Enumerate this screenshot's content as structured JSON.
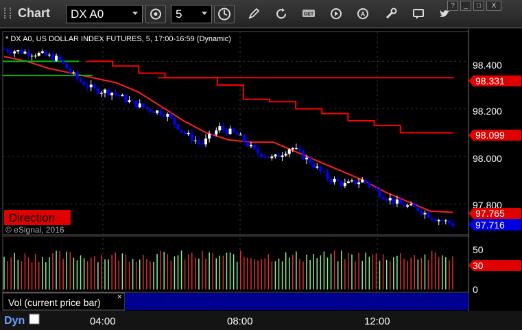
{
  "toolbar": {
    "title": "Chart",
    "symbol_value": "DX A0",
    "interval_value": "5",
    "icons": [
      "link-settings-icon",
      "clock-icon",
      "pencil-icon",
      "refresh-icon",
      "get-icon",
      "play-icon",
      "alert-icon",
      "wrench-icon",
      "comment-icon",
      "twitter-icon"
    ],
    "get_label": "GET",
    "alert_label": "A"
  },
  "window_controls": {
    "help": "?",
    "minimize": "_",
    "maximize": "□",
    "close": "X"
  },
  "chart": {
    "header": "* DX A0, US DOLLAR INDEX FUTURES, 5, 17:00-16:59 (Dynamic)",
    "watermark": "© eSignal, 2016",
    "direction_label": "Direction",
    "price_axis_ticks": [
      "98.400",
      "98.200",
      "98.000",
      "97.800"
    ],
    "price_markers": [
      {
        "value": "98.331",
        "color": "#e00000"
      },
      {
        "value": "98.099",
        "color": "#e00000"
      },
      {
        "value": "97.765",
        "color": "#e00000"
      },
      {
        "value": "97.716",
        "color": "#0000e0"
      }
    ],
    "volume_axis_ticks": [
      "50",
      "0"
    ],
    "volume_marker": "30",
    "study_label": "Vol (current price bar)",
    "study_close": "×",
    "time_ticks": [
      "04:00",
      "08:00",
      "12:00"
    ],
    "dyn_label": "Dyn",
    "colors": {
      "up": "#ffffff",
      "down": "#0000ff",
      "ma_fast": "#ff2020",
      "ma_slow": "#ff0000",
      "support": "#00c000",
      "vol_up": "#90ee90",
      "vol_down": "#e03030"
    }
  },
  "chart_data": {
    "type": "candlestick",
    "title": "DX A0, US DOLLAR INDEX FUTURES, 5, 17:00-16:59 (Dynamic)",
    "x": [
      "04:00",
      "08:00",
      "12:00"
    ],
    "ylim": [
      97.7,
      98.45
    ],
    "price_series_approx": [
      98.45,
      98.44,
      98.43,
      98.41,
      98.33,
      98.28,
      98.27,
      98.23,
      98.2,
      98.18,
      98.1,
      98.05,
      98.12,
      98.09,
      98.02,
      97.99,
      98.04,
      97.98,
      97.91,
      97.88,
      97.9,
      97.84,
      97.8,
      97.78,
      97.74,
      97.716
    ],
    "moving_average_red": [
      98.42,
      98.4,
      98.37,
      98.35,
      98.33,
      98.31,
      98.27,
      98.21,
      98.15,
      98.1,
      98.07,
      98.06,
      98.06,
      98.02,
      97.98,
      97.94,
      97.9,
      97.85,
      97.81,
      97.77,
      97.765
    ],
    "step_line_red": [
      98.4,
      98.38,
      98.35,
      98.331,
      98.331,
      98.3,
      98.24,
      98.23,
      98.2,
      98.18,
      98.15,
      98.13,
      98.1,
      98.099
    ],
    "support_green": [
      98.4,
      98.34
    ],
    "volume_max": 50
  }
}
